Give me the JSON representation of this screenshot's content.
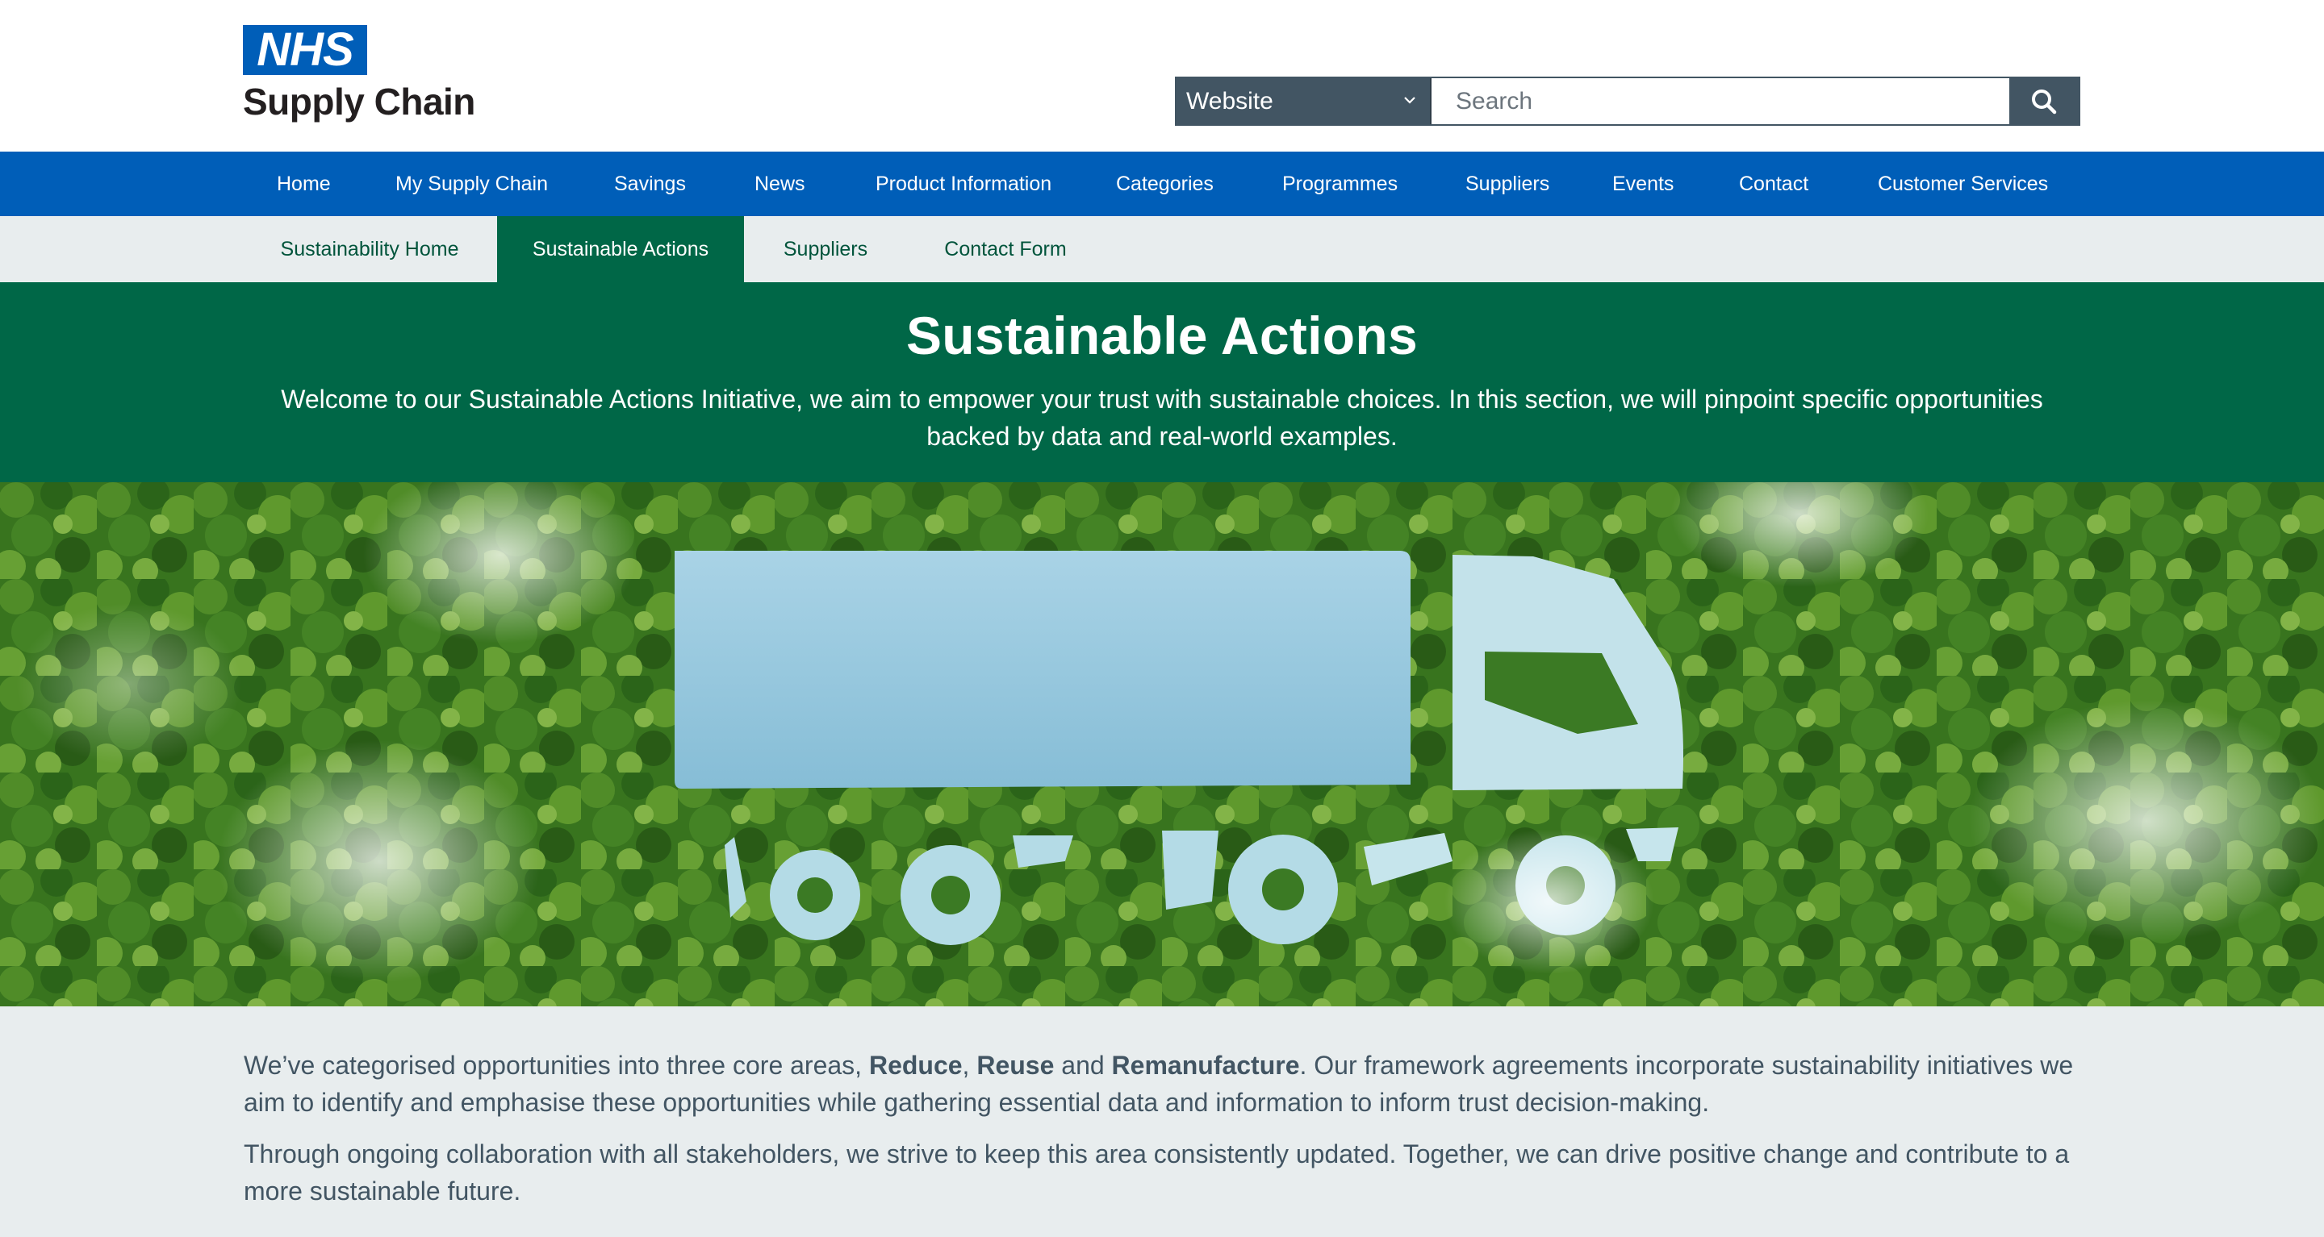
{
  "header": {
    "logo": {
      "badge": "NHS",
      "subtitle": "Supply Chain"
    },
    "search": {
      "scope_selected": "Website",
      "placeholder": "Search",
      "button_icon": "search-icon"
    }
  },
  "main_nav": {
    "items": [
      {
        "label": "Home"
      },
      {
        "label": "My Supply Chain"
      },
      {
        "label": "Savings"
      },
      {
        "label": "News"
      },
      {
        "label": "Product Information"
      },
      {
        "label": "Categories"
      },
      {
        "label": "Programmes"
      },
      {
        "label": "Suppliers"
      },
      {
        "label": "Events"
      },
      {
        "label": "Contact"
      },
      {
        "label": "Customer Services"
      }
    ]
  },
  "sub_nav": {
    "items": [
      {
        "label": "Sustainability Home"
      },
      {
        "label": "Sustainable Actions",
        "active": true
      },
      {
        "label": "Suppliers"
      },
      {
        "label": "Contact Form"
      }
    ]
  },
  "hero": {
    "title": "Sustainable Actions",
    "intro": "Welcome to our Sustainable Actions Initiative, we aim to empower your trust with sustainable choices. In this section, we will pinpoint specific opportunities backed by data and real-world examples."
  },
  "content": {
    "p1_start": "We’ve categorised opportunities into three core areas, ",
    "p1_reduce": "Reduce",
    "p1_comma": ", ",
    "p1_reuse": "Reuse",
    "p1_and": " and ",
    "p1_reman": "Remanufacture",
    "p1_end": ". Our framework agreements incorporate sustainability initiatives we aim to identify and emphasise these opportunities while gathering essential data and information to inform trust decision-making.",
    "p2": "Through ongoing collaboration with all stakeholders, we strive to keep this area consistently updated. Together, we can drive positive change and contribute to a more sustainable future."
  },
  "colors": {
    "nhs_blue": "#005eb8",
    "nhs_green": "#006747",
    "nav_grey": "#e8edee",
    "search_grey": "#425563",
    "text_grey": "#425563"
  }
}
